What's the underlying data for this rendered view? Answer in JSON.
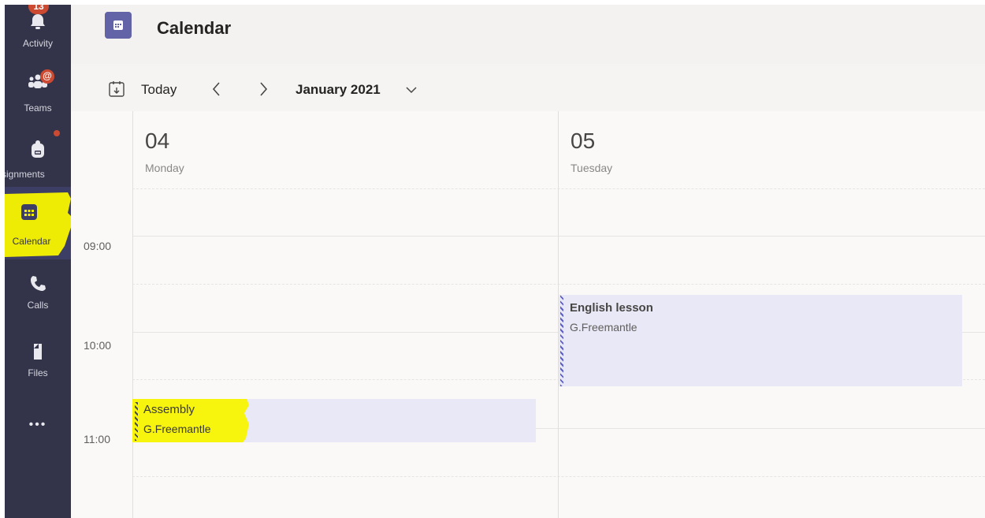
{
  "rail": {
    "activity": {
      "label": "Activity",
      "badge": "13"
    },
    "teams": {
      "label": "Teams",
      "badge": "@"
    },
    "assignments": {
      "label": "ssignments"
    },
    "calendar": {
      "label": "Calendar"
    },
    "calls": {
      "label": "Calls"
    },
    "files": {
      "label": "Files"
    },
    "more": {
      "label": "•••"
    }
  },
  "header": {
    "title": "Calendar"
  },
  "toolbar": {
    "today_label": "Today",
    "prev_icon": "chevron-left",
    "next_icon": "chevron-right",
    "month_label": "January 2021"
  },
  "days": [
    {
      "number": "04",
      "name": "Monday"
    },
    {
      "number": "05",
      "name": "Tuesday"
    }
  ],
  "times": [
    "09:00",
    "10:00",
    "11:00"
  ],
  "events": [
    {
      "title": "English lesson",
      "organizer": "G.Freemantle",
      "day": "05",
      "start": "09:45",
      "end": "10:45"
    },
    {
      "title": "Assembly",
      "organizer": "G.Freemantle",
      "day": "04",
      "start": "10:50",
      "end": "11:20",
      "highlighted": true
    }
  ],
  "colors": {
    "rail_bg": "#33344a",
    "accent": "#6264a7",
    "badge": "#cc4a31",
    "event_bg": "#e8e8f6",
    "highlight": "#f8f400"
  }
}
